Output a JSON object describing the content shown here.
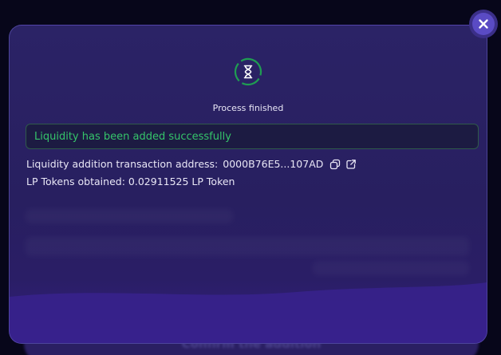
{
  "background": {
    "confirm_button_label": "Confirm the addition"
  },
  "modal": {
    "status_icon": "hourglass-icon",
    "status_text": "Process finished",
    "success_message": "Liquidity has been added successfully",
    "tx_address_label": "Liquidity addition transaction address:",
    "tx_address_value": "0000B76E5...107AD",
    "lp_tokens_label": "LP Tokens obtained:",
    "lp_tokens_value": "0.02911525 LP Token",
    "close_icon": "close-icon",
    "copy_icon": "copy-icon",
    "external_link_icon": "external-link-icon"
  },
  "colors": {
    "success": "#35c46a",
    "modal_bg": "#2b2366",
    "accent": "#5a4bc4"
  }
}
